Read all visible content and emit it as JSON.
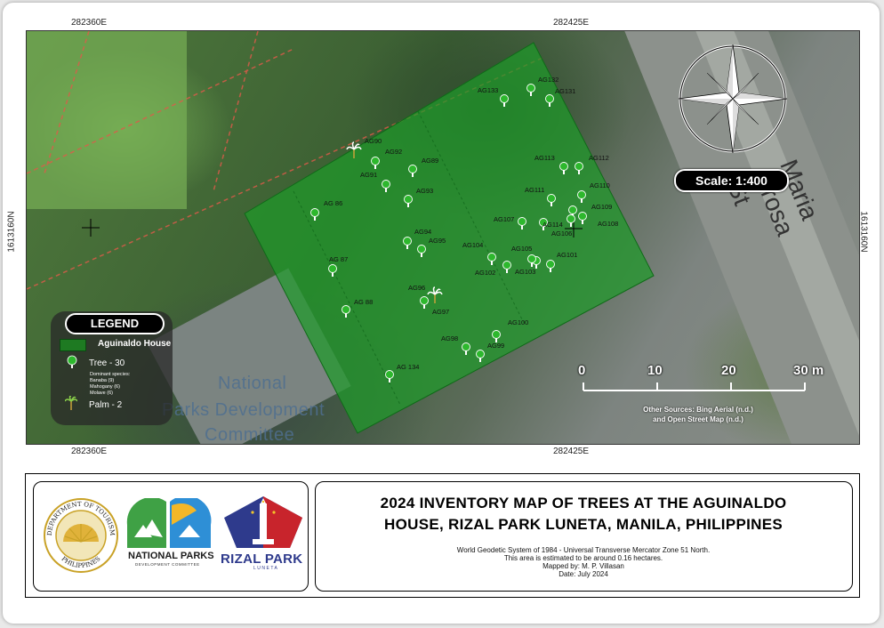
{
  "map": {
    "coords": {
      "top_left_e": "282360E",
      "top_right_e": "282425E",
      "bottom_left_e": "282360E",
      "bottom_right_e": "282425E",
      "left_n": "1613160N",
      "right_n": "1613160N"
    },
    "scale_text": "Scale: 1:400",
    "scalebar": {
      "labels": [
        "0",
        "10",
        "20",
        "30 m"
      ]
    },
    "sources": [
      "Other Sources: Bing Aerial (n.d.)",
      "and Open Street Map (n.d.)"
    ],
    "background_labels": {
      "road": "Maria Orosa St",
      "building_1": "National",
      "building_2": "Parks Development",
      "building_3": "Committee"
    },
    "colors": {
      "polygon": "#1e9a2a",
      "tree": "#2db82d"
    },
    "trees": [
      {
        "id": "AG133"
      },
      {
        "id": "AG132"
      },
      {
        "id": "AG131"
      },
      {
        "id": "AG90"
      },
      {
        "id": "AG92"
      },
      {
        "id": "AG89"
      },
      {
        "id": "AG91"
      },
      {
        "id": "AG93"
      },
      {
        "id": "AG113"
      },
      {
        "id": "AG112"
      },
      {
        "id": "AG111"
      },
      {
        "id": "AG110"
      },
      {
        "id": "AG109"
      },
      {
        "id": "AG 86"
      },
      {
        "id": "AG107"
      },
      {
        "id": "AG114"
      },
      {
        "id": "AG106"
      },
      {
        "id": "AG108"
      },
      {
        "id": "AG94"
      },
      {
        "id": "AG95"
      },
      {
        "id": "AG104"
      },
      {
        "id": "AG105"
      },
      {
        "id": "AG101"
      },
      {
        "id": "AG 87"
      },
      {
        "id": "AG102"
      },
      {
        "id": "AG103"
      },
      {
        "id": "AG96"
      },
      {
        "id": "AG97"
      },
      {
        "id": "AG 88"
      },
      {
        "id": "AG100"
      },
      {
        "id": "AG98"
      },
      {
        "id": "AG99"
      },
      {
        "id": "AG 134"
      }
    ]
  },
  "legend": {
    "title": "LEGEND",
    "polygon_label": "Aguinaldo House",
    "tree_label": "Tree - 30",
    "species_header": "Dominant species:",
    "species": [
      "Banaba (9)",
      "Mahogany (6)",
      "Molave (6)"
    ],
    "palm_label": "Palm - 2"
  },
  "logos": {
    "dot_seal_top": "DEPARTMENT OF TOURISM",
    "dot_seal_bottom": "PHILIPPINES",
    "npdc_title": "NATIONAL PARKS",
    "npdc_sub": "DEVELOPMENT COMMITTEE",
    "rizal_title": "RIZAL PARK",
    "rizal_sub": "LUNETA"
  },
  "title": {
    "line1": "2024 INVENTORY MAP OF TREES AT THE AGUINALDO",
    "line2": "HOUSE, RIZAL PARK LUNETA, MANILA, PHILIPPINES"
  },
  "meta": {
    "datum": "World Geodetic System of 1984 - Universal Transverse Mercator Zone 51 North.",
    "area": "This area is estimated to be around 0.16 hectares.",
    "mapped_by": "Mapped by: M. P. Villasan",
    "date": "Date: July 2024"
  }
}
